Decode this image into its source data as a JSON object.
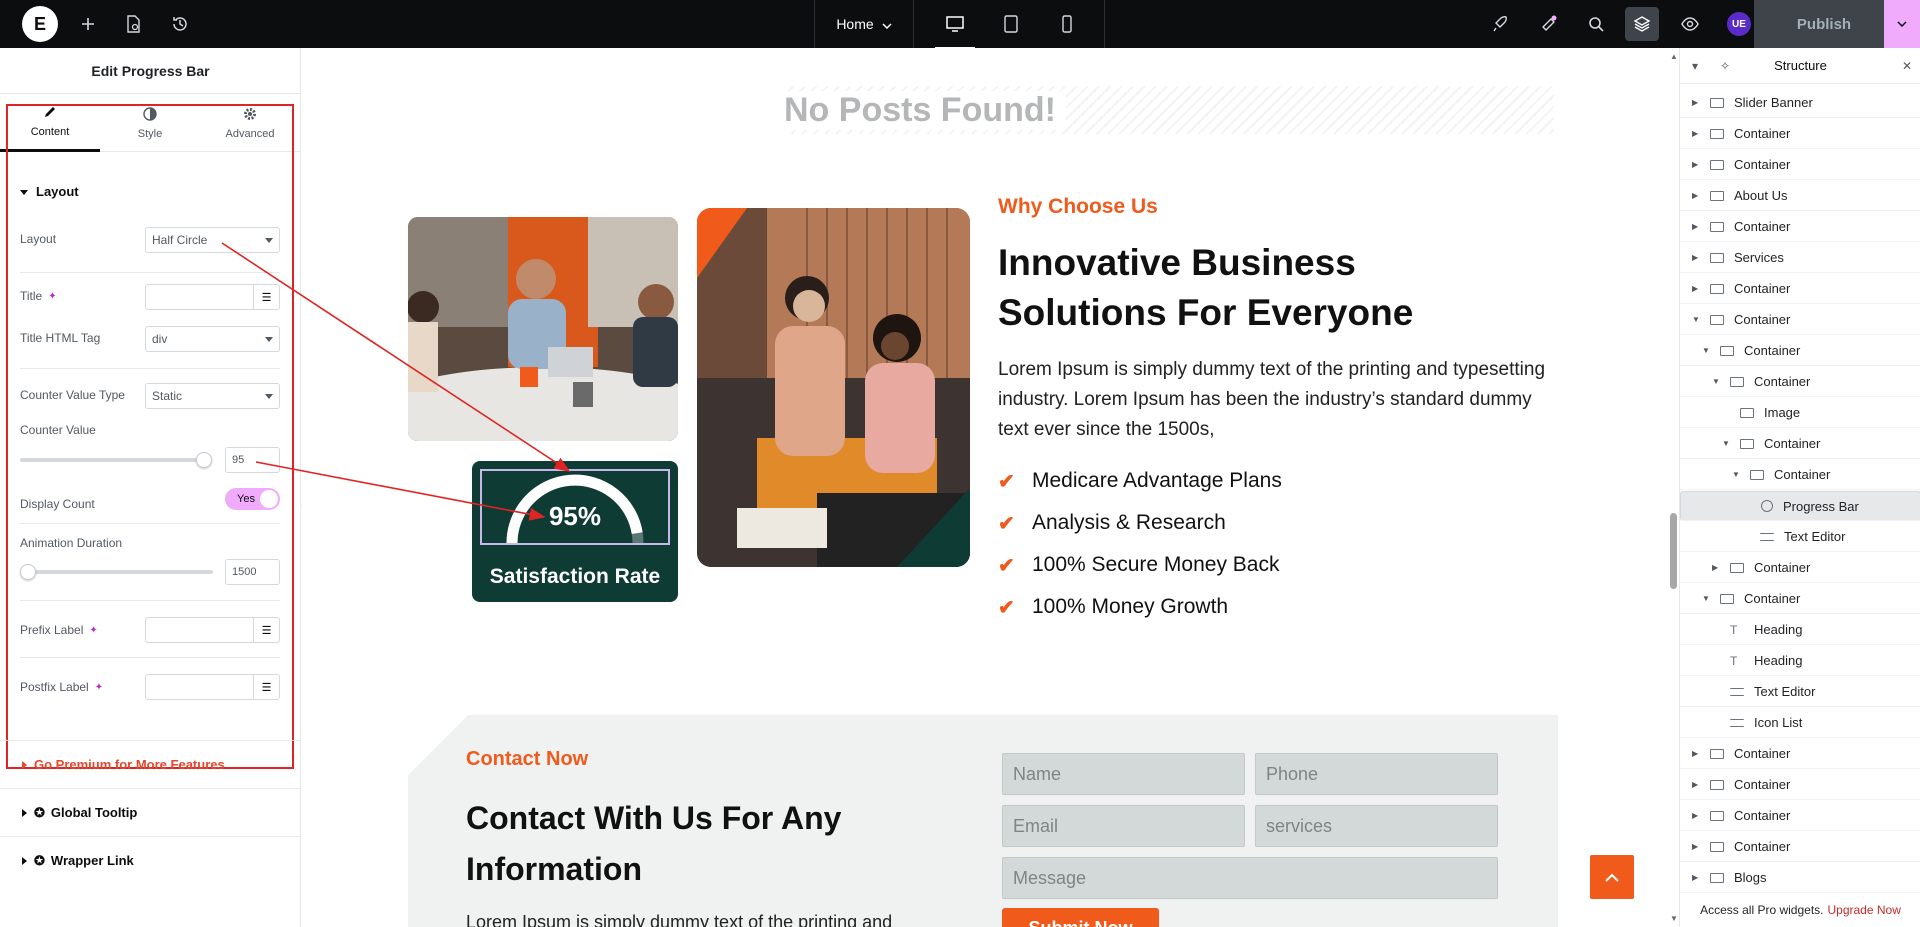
{
  "topbar": {
    "page": "Home",
    "publish": "Publish",
    "user_initials": "UE"
  },
  "panel": {
    "title": "Edit Progress Bar",
    "tabs": [
      "Content",
      "Style",
      "Advanced"
    ],
    "section": "Layout",
    "fields": {
      "layout_label": "Layout",
      "layout_value": "Half Circle",
      "title_label": "Title",
      "title_value": "",
      "title_tag_label": "Title HTML Tag",
      "title_tag_value": "div",
      "counter_type_label": "Counter Value Type",
      "counter_type_value": "Static",
      "counter_value_label": "Counter Value",
      "counter_value": "95",
      "display_count_label": "Display Count",
      "display_count_value": "Yes",
      "animation_label": "Animation Duration",
      "animation_value": "1500",
      "prefix_label": "Prefix Label",
      "postfix_label": "Postfix Label"
    },
    "accordions": {
      "premium": "Go Premium for More Features",
      "tooltip": "Global Tooltip",
      "wrapper": "Wrapper Link"
    }
  },
  "canvas": {
    "no_posts": "No Posts Found!",
    "progress_value": "95%",
    "progress_fraction": 0.95,
    "progress_title": "Satisfaction Rate",
    "why": "Why Choose Us",
    "heading": "Innovative Business Solutions For Everyone",
    "body": "Lorem Ipsum is simply dummy text of the printing and typesetting industry. Lorem Ipsum has been the industry’s standard dummy text ever since the 1500s,",
    "checks": [
      "Medicare Advantage Plans",
      "Analysis & Research",
      "100% Secure Money Back",
      "100% Money Growth"
    ],
    "contact_small": "Contact Now",
    "contact_heading": "Contact With Us For Any Information",
    "contact_body": "Lorem Ipsum is simply dummy text of the printing and",
    "form": {
      "name": "Name",
      "phone": "Phone",
      "email": "Email",
      "services": "services",
      "message": "Message",
      "submit": "Submit Now"
    }
  },
  "structure": {
    "title": "Structure",
    "nodes": [
      {
        "label": "Slider Banner",
        "depth": 0,
        "icon": "container",
        "arrow": "right"
      },
      {
        "label": "Container",
        "depth": 0,
        "icon": "container",
        "arrow": "right"
      },
      {
        "label": "Container",
        "depth": 0,
        "icon": "container",
        "arrow": "right"
      },
      {
        "label": "About Us",
        "depth": 0,
        "icon": "container",
        "arrow": "right"
      },
      {
        "label": "Container",
        "depth": 0,
        "icon": "container",
        "arrow": "right"
      },
      {
        "label": "Services",
        "depth": 0,
        "icon": "container",
        "arrow": "right"
      },
      {
        "label": "Container",
        "depth": 0,
        "icon": "container",
        "arrow": "right"
      },
      {
        "label": "Container",
        "depth": 0,
        "icon": "container",
        "arrow": "down"
      },
      {
        "label": "Container",
        "depth": 1,
        "icon": "container",
        "arrow": "down"
      },
      {
        "label": "Container",
        "depth": 2,
        "icon": "container",
        "arrow": "down"
      },
      {
        "label": "Image",
        "depth": 3,
        "icon": "image",
        "arrow": ""
      },
      {
        "label": "Container",
        "depth": 3,
        "icon": "container",
        "arrow": "down"
      },
      {
        "label": "Container",
        "depth": 4,
        "icon": "container",
        "arrow": "down"
      },
      {
        "label": "Progress Bar",
        "depth": 5,
        "icon": "progress",
        "arrow": "",
        "selected": true
      },
      {
        "label": "Text Editor",
        "depth": 5,
        "icon": "text",
        "arrow": ""
      },
      {
        "label": "Container",
        "depth": 2,
        "icon": "container",
        "arrow": "right"
      },
      {
        "label": "Container",
        "depth": 1,
        "icon": "container",
        "arrow": "down"
      },
      {
        "label": "Heading",
        "depth": 2,
        "icon": "heading",
        "arrow": ""
      },
      {
        "label": "Heading",
        "depth": 2,
        "icon": "heading",
        "arrow": ""
      },
      {
        "label": "Text Editor",
        "depth": 2,
        "icon": "text",
        "arrow": ""
      },
      {
        "label": "Icon List",
        "depth": 2,
        "icon": "list",
        "arrow": ""
      },
      {
        "label": "Container",
        "depth": 0,
        "icon": "container",
        "arrow": "right"
      },
      {
        "label": "Container",
        "depth": 0,
        "icon": "container",
        "arrow": "right"
      },
      {
        "label": "Container",
        "depth": 0,
        "icon": "container",
        "arrow": "right"
      },
      {
        "label": "Container",
        "depth": 0,
        "icon": "container",
        "arrow": "right"
      },
      {
        "label": "Blogs",
        "depth": 0,
        "icon": "container",
        "arrow": "right"
      }
    ],
    "footer_text": "Access all Pro widgets.",
    "footer_link": "Upgrade Now"
  }
}
